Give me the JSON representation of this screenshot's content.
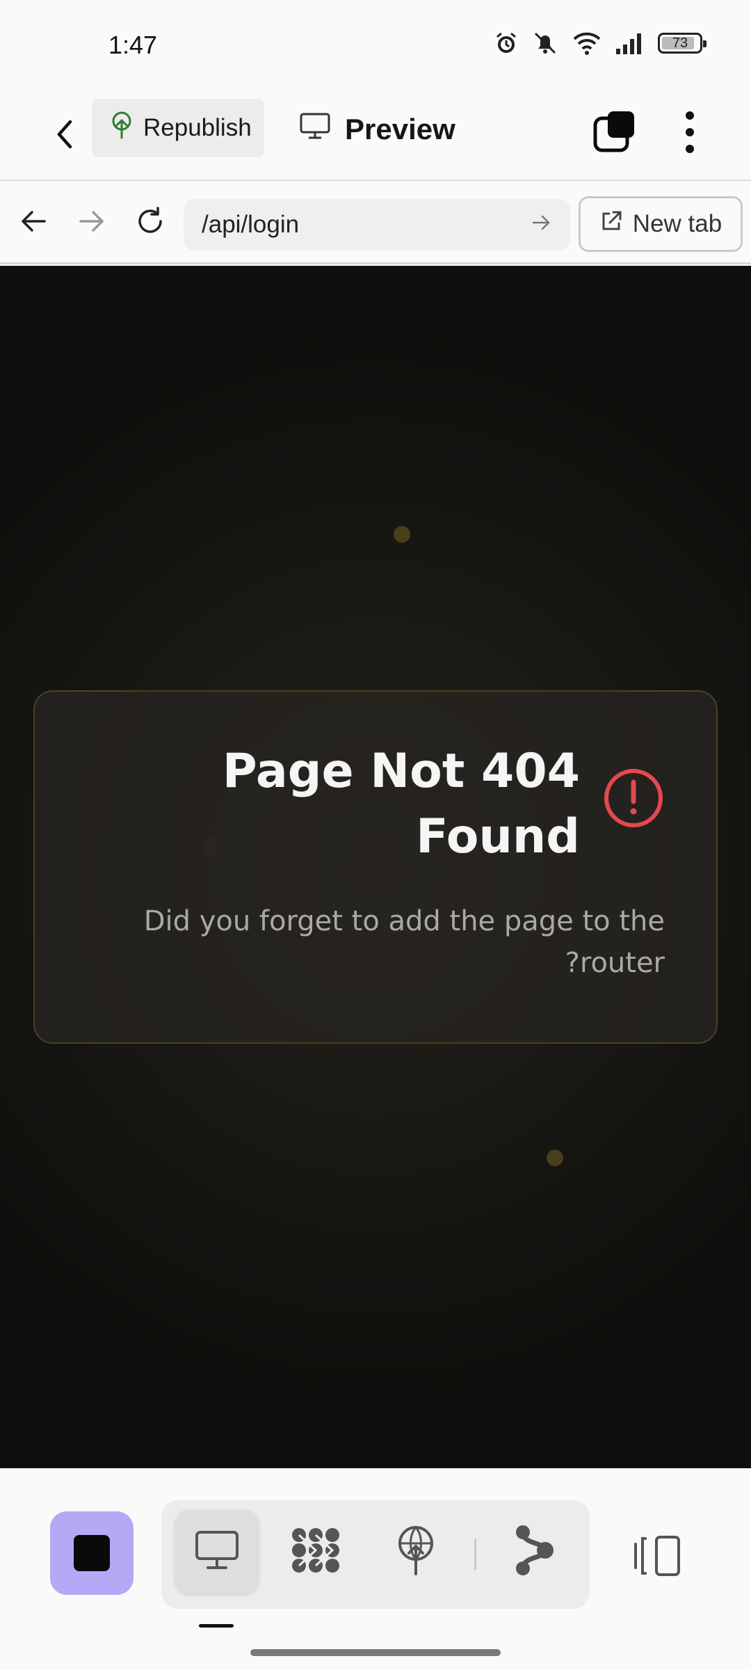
{
  "status_bar": {
    "time": "1:47",
    "battery": "73"
  },
  "toolbar": {
    "republish_label": "Republish",
    "preview_label": "Preview"
  },
  "browser": {
    "url": "/api/login",
    "new_tab_label": "New tab"
  },
  "page": {
    "error_title": "Page Not 404 Found",
    "error_message": "Did you forget to add the page to the ?router"
  },
  "colors": {
    "stop_accent": "#b7a8f5",
    "error_red": "#e5484d",
    "republish_green": "#2f7d32"
  },
  "icons": {
    "back": "chevron-left-icon",
    "republish": "tree-upload-icon",
    "preview": "monitor-icon",
    "panels": "stacked-squares-icon",
    "more": "vertical-dots-icon",
    "nav_back": "arrow-left-icon",
    "nav_forward": "arrow-right-icon",
    "reload": "reload-icon",
    "url_go": "arrow-right-icon",
    "new_tab": "external-link-icon",
    "error": "alert-circle-icon",
    "stop": "stop-icon",
    "desktop_view": "monitor-icon",
    "workflow": "nodes-icon",
    "deploy": "tree-upload-icon",
    "branch": "branch-icon",
    "device": "device-frame-icon"
  }
}
